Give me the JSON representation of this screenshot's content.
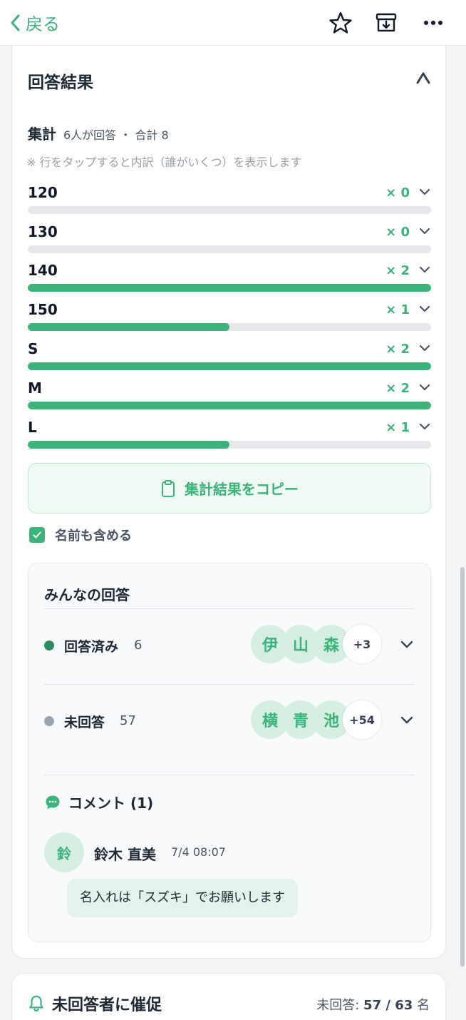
{
  "nav": {
    "back_label": "戻る",
    "star_icon": "star-icon",
    "archive_icon": "archive-download-icon",
    "more_icon": "more-icon"
  },
  "result": {
    "title": "回答結果",
    "summary_label": "集計",
    "summary_meta": "6人が回答 ・ 合計 8",
    "note": "※ 行をタップすると内訳（誰がいくつ）を表示します",
    "options": [
      {
        "label": "120",
        "count": "× 0",
        "fraction": 0
      },
      {
        "label": "130",
        "count": "× 0",
        "fraction": 0
      },
      {
        "label": "140",
        "count": "× 2",
        "fraction": 1
      },
      {
        "label": "150",
        "count": "× 1",
        "fraction": 0.5
      },
      {
        "label": "S",
        "count": "× 2",
        "fraction": 1
      },
      {
        "label": "M",
        "count": "× 2",
        "fraction": 1
      },
      {
        "label": "L",
        "count": "× 1",
        "fraction": 0.5
      }
    ],
    "copy_label": "集計結果をコピー",
    "include_names_label": "名前も含める",
    "include_names_checked": true
  },
  "responses": {
    "title": "みんなの回答",
    "answered": {
      "label": "回答済み",
      "count": "6",
      "avatars": [
        "伊",
        "山",
        "森"
      ],
      "more": "+3",
      "dot_color": "#2e8b5f"
    },
    "unanswered": {
      "label": "未回答",
      "count": "57",
      "avatars": [
        "横",
        "青",
        "池"
      ],
      "more": "+54",
      "dot_color": "#9aa4b0"
    }
  },
  "comments": {
    "title": "コメント (1)",
    "items": [
      {
        "avatar": "鈴",
        "name": "鈴木 直美",
        "time": "7/4 08:07",
        "text": "名入れは「スズキ」でお願いします"
      }
    ]
  },
  "remind": {
    "title": "未回答者に催促",
    "stat_label": "未回答:",
    "stat_value": "57 / 63",
    "stat_unit": "名"
  },
  "colors": {
    "accent": "#3bb37a",
    "bar_track": "#e5e7eb"
  }
}
